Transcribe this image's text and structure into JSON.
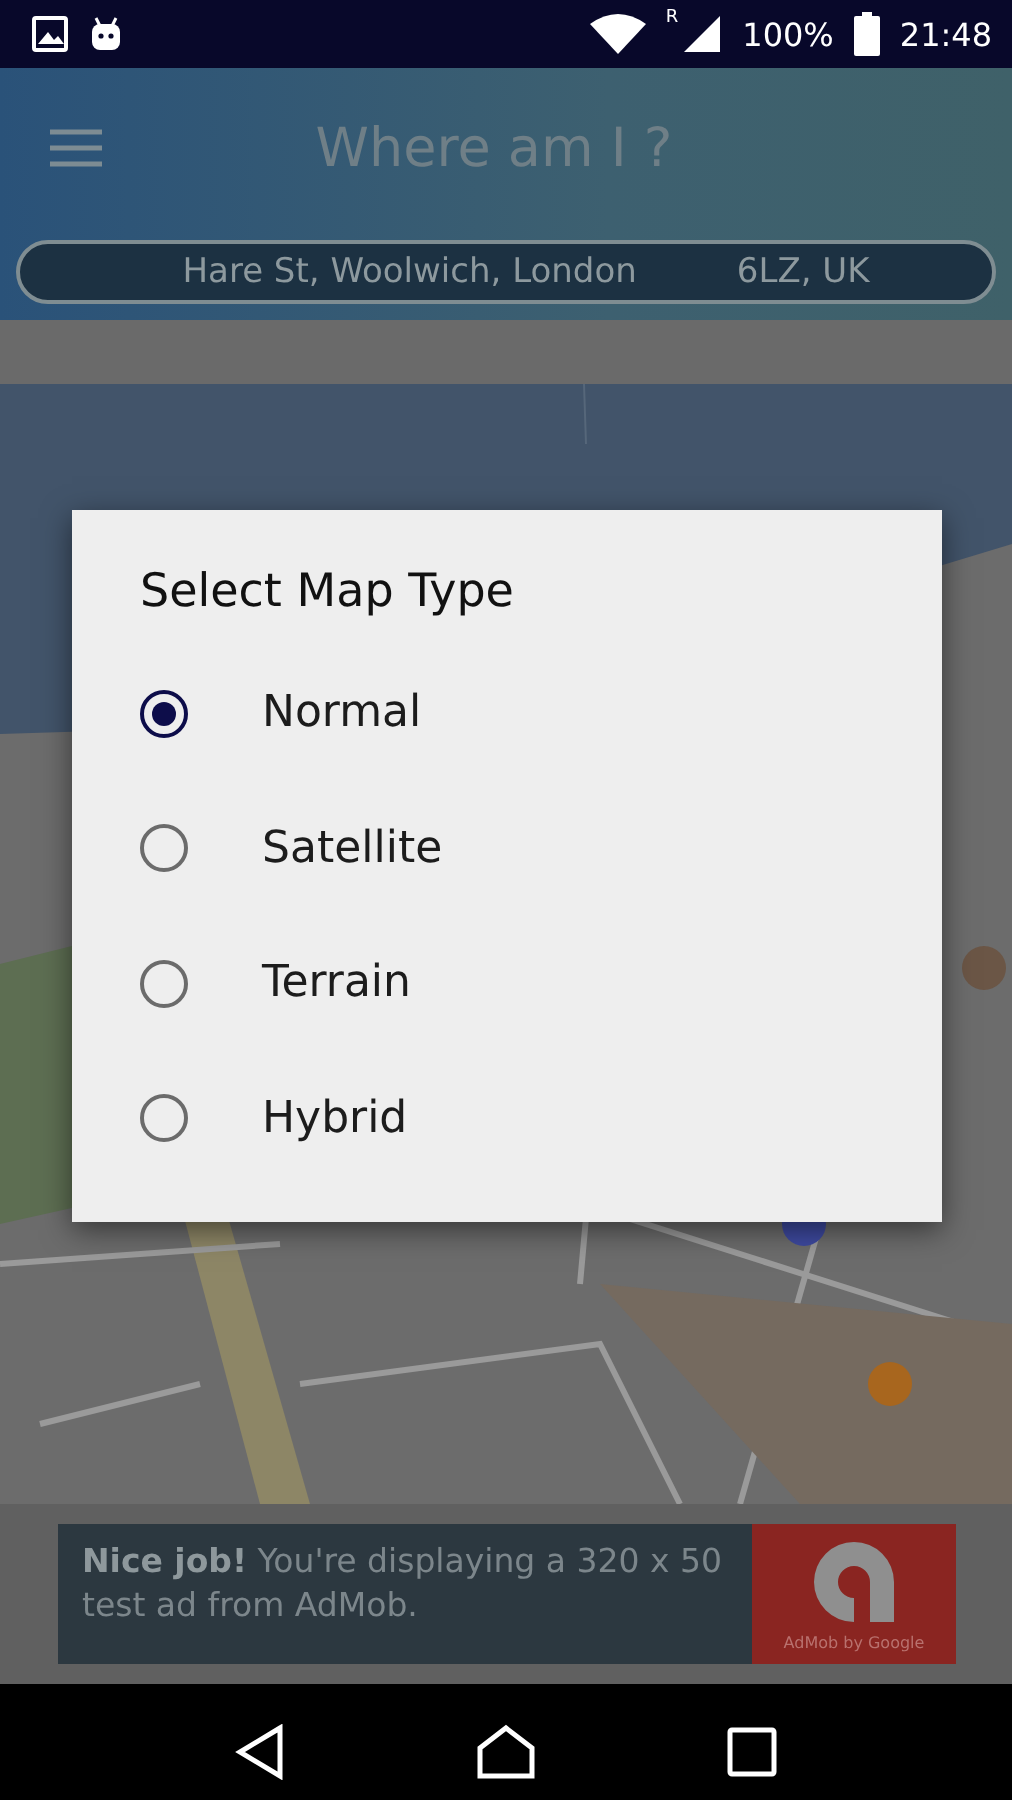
{
  "status_bar": {
    "roaming": "R",
    "battery": "100%",
    "time": "21:48"
  },
  "app_bar": {
    "title": "Where am I ?",
    "address": "Hare St, Woolwich, London",
    "address_tail": "6LZ, UK"
  },
  "dialog": {
    "title": "Select Map Type",
    "options": [
      {
        "label": "Normal",
        "selected": true
      },
      {
        "label": "Satellite",
        "selected": false
      },
      {
        "label": "Terrain",
        "selected": false
      },
      {
        "label": "Hybrid",
        "selected": false
      }
    ]
  },
  "ad": {
    "text": "**Nice job!** You're displaying a 320 x 50 test ad from AdMob.",
    "brand": "AdMob by Google"
  }
}
